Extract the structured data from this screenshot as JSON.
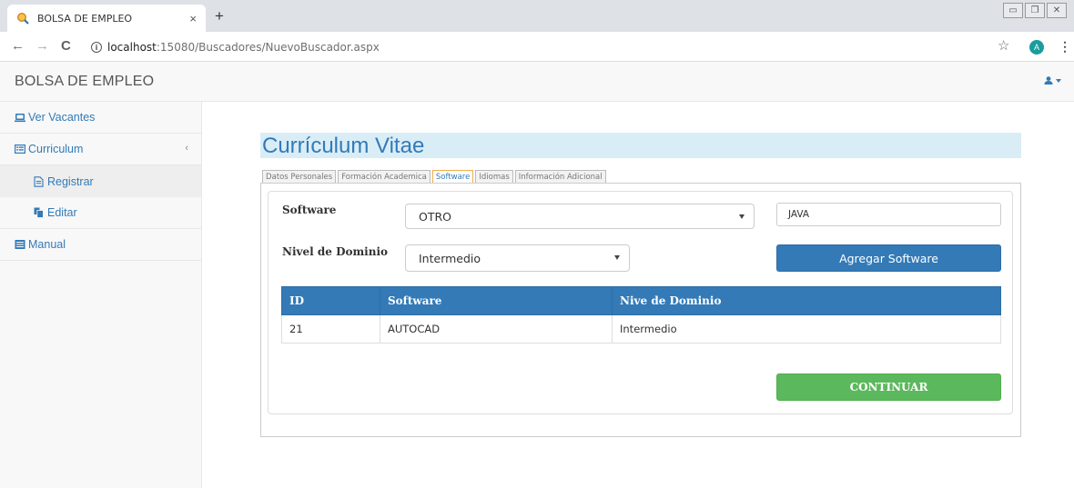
{
  "browser": {
    "tab_title": "BOLSA DE EMPLEO",
    "tab_close": "×",
    "new_tab": "+",
    "url_host": "localhost",
    "url_path": ":15080/Buscadores/NuevoBuscador.aspx",
    "profile_initial": "A",
    "nav": {
      "back": "←",
      "forward": "→",
      "reload": "C"
    },
    "star": "☆",
    "menu": "⋮"
  },
  "navbar": {
    "brand": "BOLSA DE EMPLEO"
  },
  "sidebar": {
    "items": [
      {
        "label": "Ver Vacantes"
      },
      {
        "label": "Curriculum",
        "chevron": "‹"
      },
      {
        "label": "Registrar"
      },
      {
        "label": "Editar"
      },
      {
        "label": "Manual"
      }
    ]
  },
  "main": {
    "title": "Currículum Vitae",
    "tabs": [
      {
        "label": "Datos Personales"
      },
      {
        "label": "Formación Academica"
      },
      {
        "label": "Software",
        "active": true
      },
      {
        "label": "Idiomas"
      },
      {
        "label": "Información Adicional"
      }
    ],
    "form": {
      "software_label": "Software",
      "software_selected": "OTRO",
      "other_software_value": "JAVA",
      "level_label": "Nivel de Dominio",
      "level_selected": "Intermedio",
      "add_button": "Agregar Software",
      "continue_button": "CONTINUAR"
    },
    "table": {
      "headers": [
        "ID",
        "Software",
        "Nive de Dominio"
      ],
      "rows": [
        [
          "21",
          "AUTOCAD",
          "Intermedio"
        ]
      ]
    }
  },
  "colors": {
    "primary": "#337ab7",
    "success": "#5cb85c",
    "heading_bg": "#d9edf7",
    "active_tab_border": "#f0ad4e"
  }
}
